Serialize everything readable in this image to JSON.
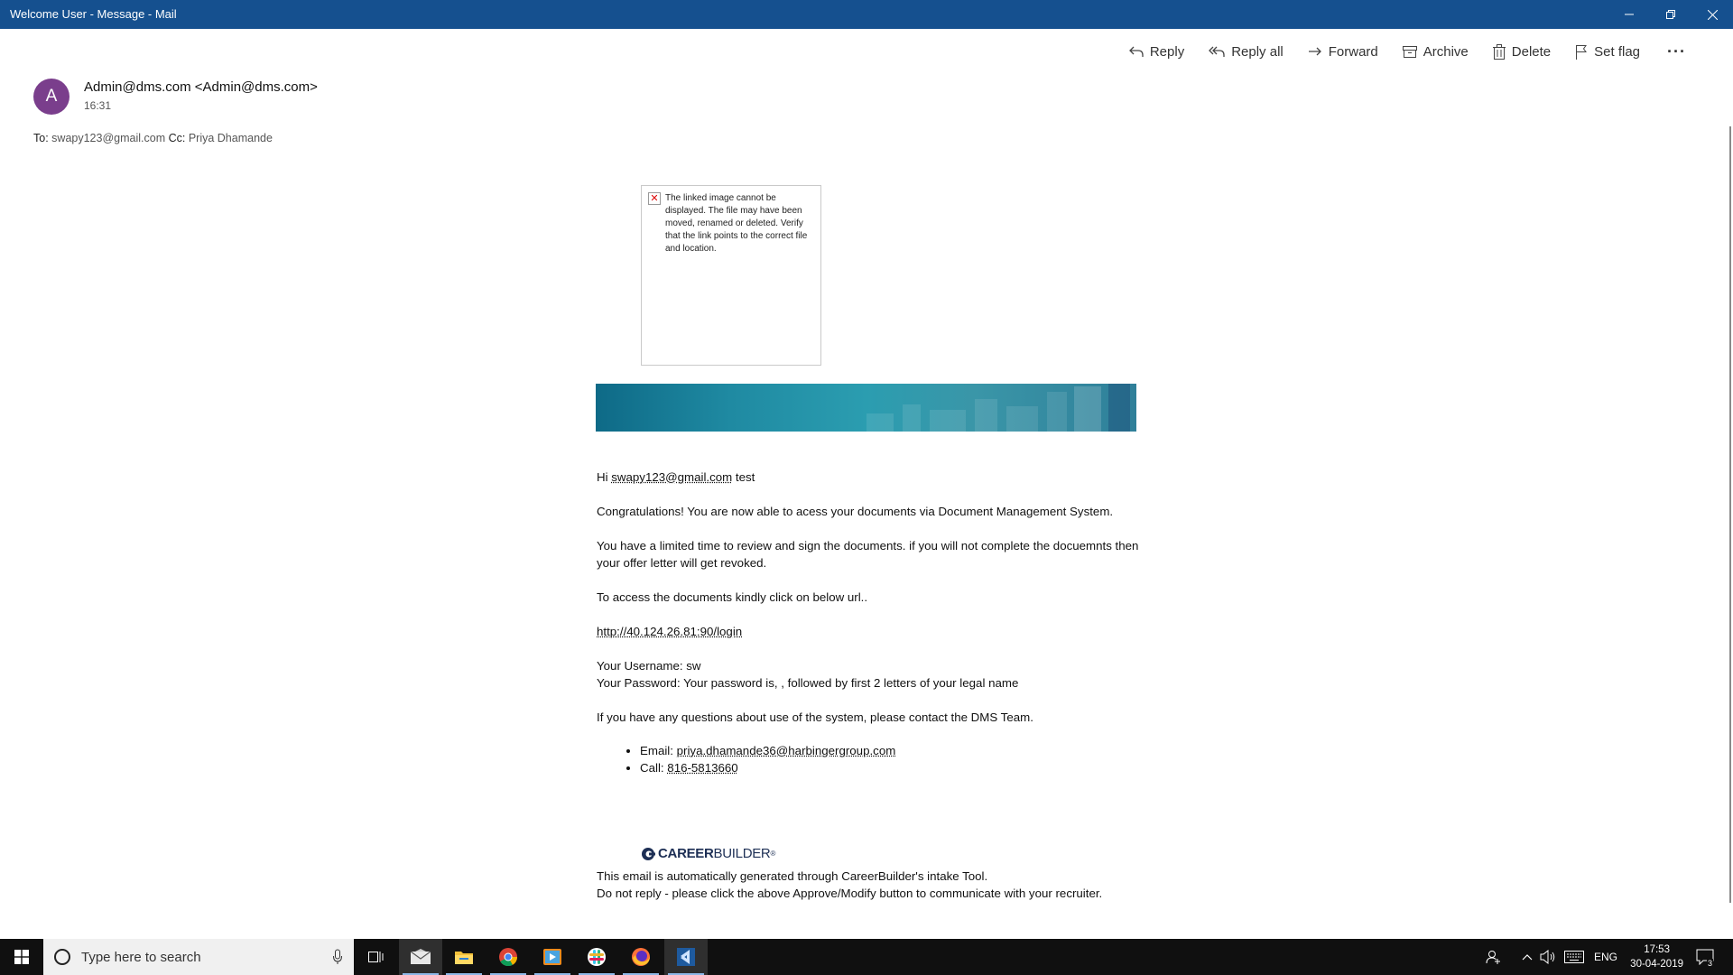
{
  "window": {
    "title": "Welcome User - Message - Mail"
  },
  "toolbar": {
    "reply": "Reply",
    "reply_all": "Reply all",
    "forward": "Forward",
    "archive": "Archive",
    "delete": "Delete",
    "set_flag": "Set flag",
    "more": "···"
  },
  "header": {
    "avatar_letter": "A",
    "sender": "Admin@dms.com <Admin@dms.com>",
    "time": "16:31",
    "to_label": "To:",
    "to_value": "swapy123@gmail.com",
    "cc_label": "Cc:",
    "cc_value": "Priya Dhamande"
  },
  "broken_image": {
    "message": "The linked image cannot be displayed. The file may have been moved, renamed or deleted. Verify that the link points to the correct file and location."
  },
  "body": {
    "greeting_prefix": "Hi ",
    "greeting_email": "swapy123@gmail.com",
    "greeting_suffix": " test",
    "congrats": "Congratulations! You are now able to acess your documents via Document Management System.",
    "limited_time": "You have a limited time to review and sign the documents. if you will not complete the docuemnts then your offer letter will get revoked.",
    "access": "To access the documents kindly click on below url..",
    "url": "http://40.124.26.81:90/login",
    "username": "Your Username: sw",
    "password": "Your Password: Your password is, , followed by first 2 letters of your legal name",
    "questions": " If you have any questions about use of the system, please contact the DMS Team.",
    "email_label": "Email: ",
    "email_value": "priya.dhamande36@harbingergroup.com",
    "call_label": "Call: ",
    "call_value": "816-5813660"
  },
  "logo": {
    "part1": "CAREER",
    "part2": "BUILDER",
    "reg": "®"
  },
  "footer": {
    "line1": "This email is automatically generated through CareerBuilder's intake Tool.",
    "line2": "Do not reply - please click the above Approve/Modify button to communicate with your recruiter."
  },
  "taskbar": {
    "search_placeholder": "Type here to search",
    "lang": "ENG",
    "time": "17:53",
    "date": "30-04-2019",
    "notification_count": "3"
  }
}
